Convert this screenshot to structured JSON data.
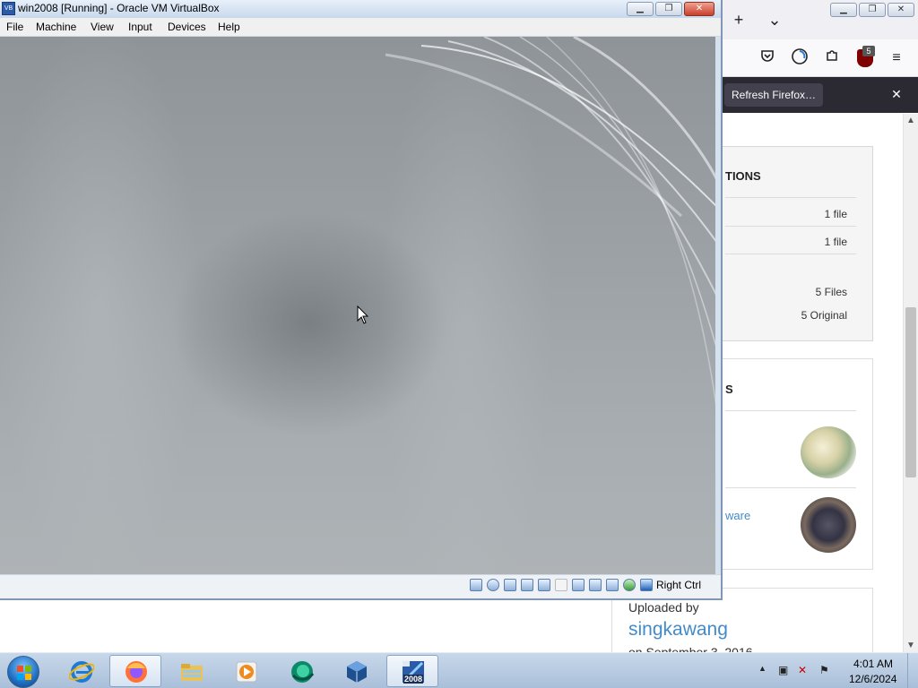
{
  "firefox": {
    "notification": {
      "refresh_label": "Refresh Firefox…",
      "close_glyph": "✕"
    },
    "toolbar": {
      "ublock_count": "5"
    },
    "page": {
      "collections": {
        "heading": "TIONS",
        "rows": [
          {
            "value": "1 file"
          },
          {
            "value": "1 file"
          },
          {
            "value": "5 Files"
          },
          {
            "value": "5 Original"
          }
        ]
      },
      "related": {
        "heading": "S",
        "link_text": "ware"
      },
      "uploader": {
        "label": "Uploaded by",
        "name": "singkawang",
        "date": "on September 3, 2016"
      }
    }
  },
  "vbox": {
    "title": "win2008 [Running] - Oracle VM VirtualBox",
    "menu": [
      "File",
      "Machine",
      "View",
      "Input",
      "Devices",
      "Help"
    ],
    "status": {
      "host_key": "Right Ctrl"
    }
  },
  "taskbar": {
    "apps": [
      {
        "name": "internet-explorer",
        "active": false
      },
      {
        "name": "firefox",
        "active": true
      },
      {
        "name": "file-explorer",
        "active": false
      },
      {
        "name": "media-player",
        "active": false
      },
      {
        "name": "browser-app",
        "active": false
      },
      {
        "name": "virtualbox",
        "active": false
      },
      {
        "name": "win2008-vm",
        "active": false,
        "label": "2008"
      }
    ],
    "clock": {
      "time": "4:01 AM",
      "date": "12/6/2024"
    }
  },
  "colors": {
    "link": "#428bca",
    "notification_bar": "#2b2a33",
    "taskbar": "#b8cce4"
  }
}
